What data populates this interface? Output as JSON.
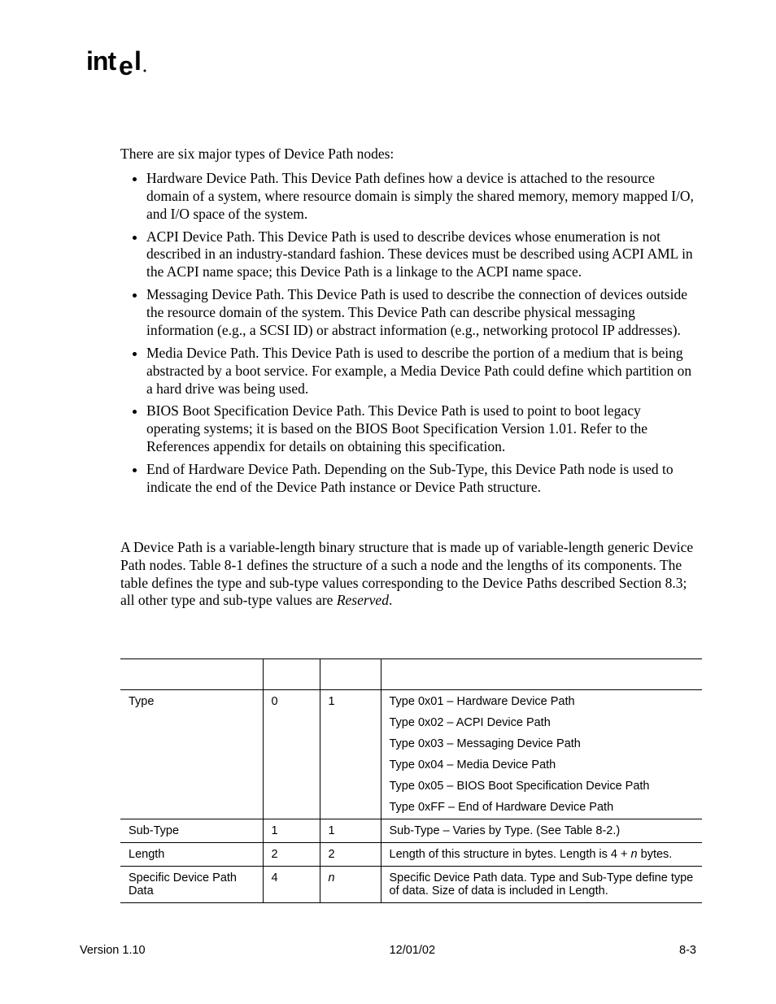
{
  "logo_alt": "intel",
  "intro": "There are six major types of Device Path nodes:",
  "bullets": [
    "Hardware Device Path.  This Device Path defines how a device is attached to the resource domain of a system, where resource domain is simply the shared memory, memory mapped I/O, and I/O space of the system.",
    "ACPI Device Path.  This Device Path is used to describe devices whose enumeration is not described in an industry-standard fashion.  These devices must be described using ACPI AML in the ACPI name space; this Device Path is a linkage to the ACPI name space.",
    "Messaging Device Path.  This Device Path is used to describe the connection of devices outside the resource domain of the system.  This Device Path can describe physical messaging information (e.g., a SCSI ID) or abstract information (e.g., networking protocol IP addresses).",
    "Media Device Path.  This Device Path is used to describe the portion of a medium that is being abstracted by a boot service.  For example, a Media Device Path could define which partition on a hard drive was being used.",
    "BIOS Boot Specification Device Path.  This Device Path is used to point to boot legacy operating systems; it is based on the BIOS Boot Specification Version 1.01.  Refer to the References appendix for details on obtaining this specification.",
    "End of Hardware Device Path.  Depending on the Sub-Type, this Device Path node is used to indicate the end of the Device Path instance or Device Path structure."
  ],
  "section_text_a": "A Device Path is a variable-length binary structure that is made up of variable-length generic Device Path nodes.  Table 8-1 defines the structure of a such a node and the lengths of its components.  The table defines the type and sub-type values corresponding to the Device Paths described Section 8.3; all other type and sub-type values are ",
  "section_text_b": "Reserved",
  "section_text_c": ".",
  "table": {
    "headers": [
      "",
      "",
      "",
      ""
    ],
    "rows": [
      {
        "mnemonic": "Type",
        "byte": "0",
        "len": "1",
        "desc_lines": [
          "Type 0x01 – Hardware Device Path",
          "Type 0x02 – ACPI Device Path",
          "Type 0x03 – Messaging Device Path",
          "Type 0x04 – Media Device Path",
          "Type 0x05 – BIOS Boot Specification Device Path",
          "Type 0xFF – End of Hardware Device Path"
        ]
      },
      {
        "mnemonic": "Sub-Type",
        "byte": "1",
        "len": "1",
        "desc_lines": [
          "Sub-Type – Varies by Type. (See Table 8-2.)"
        ]
      },
      {
        "mnemonic": "Length",
        "byte": "2",
        "len": "2",
        "desc_html": "Length of this structure in bytes.  Length is 4 + <span class=\"italic-n\">n</span> bytes."
      },
      {
        "mnemonic": "Specific Device Path Data",
        "byte": "4",
        "len_html": "<span class=\"italic-n\">n</span>",
        "desc_lines": [
          "Specific Device Path data.  Type and Sub-Type define type of data.  Size of data is included in Length."
        ]
      }
    ]
  },
  "footer": {
    "left": "Version 1.10",
    "center": "12/01/02",
    "right": "8-3"
  }
}
